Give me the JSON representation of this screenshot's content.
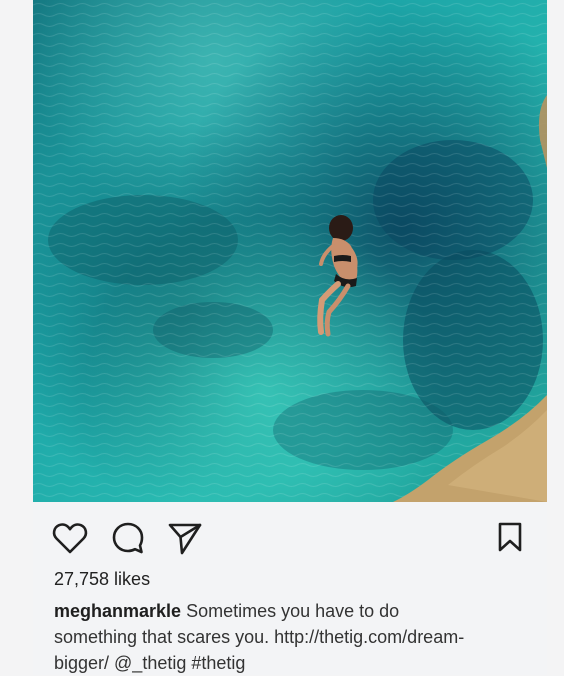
{
  "post": {
    "photo": {
      "description_icon": "cliff-diver-photo"
    },
    "actions": {
      "like_icon": "heart-icon",
      "comment_icon": "comment-icon",
      "share_icon": "send-icon",
      "save_icon": "bookmark-icon"
    },
    "likes_text": "27,758 likes",
    "caption": {
      "username": "meghanmarkle",
      "line1_text": " Sometimes you have to do",
      "line2_text": "something that scares you. http://thetig.com/dream-",
      "line3_text": "bigger/ @_thetig #thetig"
    },
    "colors": {
      "background": "#f3f4f6",
      "text": "#222222",
      "water_light": "#23b7b5",
      "water_dark": "#0c5f73",
      "rock": "#c3a26c"
    }
  }
}
